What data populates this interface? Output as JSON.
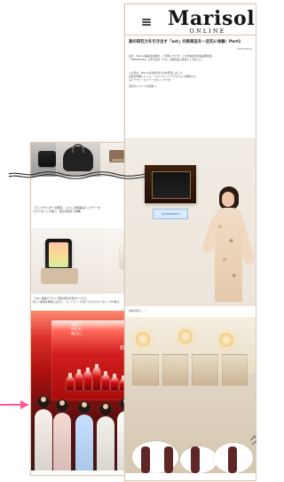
{
  "brand": {
    "name": "Marisol",
    "subtitle": "ONLINE"
  },
  "right_card": {
    "title": "美の研究力を引き出す「est」の新商品を一足先に体験♪ Part1",
    "date": "2024.06.04",
    "paragraph_1": "先日、Marisol編集部主催の、ご招待いただき、この日本初の新商品発表会。\n「SERENITIES」を引き出す「est」の講演会に参加してきました。",
    "paragraph_2": "この日は、Marisol読者の皆さまを招待しました。\n実感が体験したこと、ベストフレンドアクセスとも関係する。\nest アプリ・マイページのリンクです。",
    "paragraph_3": "当日のイベントの記事へ。",
    "wall_label": "est RESEARCH",
    "hotel_caption": "会場の様子 ……"
  },
  "left_card": {
    "headline": "「ビッグサンダーの研究」 エストの新美白ビッグデータ\nカウンセリング術で、肌の分析まで体験",
    "tag": "SALON",
    "caption": "「est」独自のアプリで肌の研究を重ねてくれる。\n新しい美容を体験しながら、フィッティングまでできるカウンセリングの様子。",
    "poster_text": "美容で、\n研究を、\n毎日に。",
    "poster_brand": "est"
  },
  "annotations": {
    "outer_char": "ク"
  },
  "colors": {
    "accent": "#ff5b9a",
    "gold": "#c7b08a",
    "brand_text": "#151515"
  }
}
